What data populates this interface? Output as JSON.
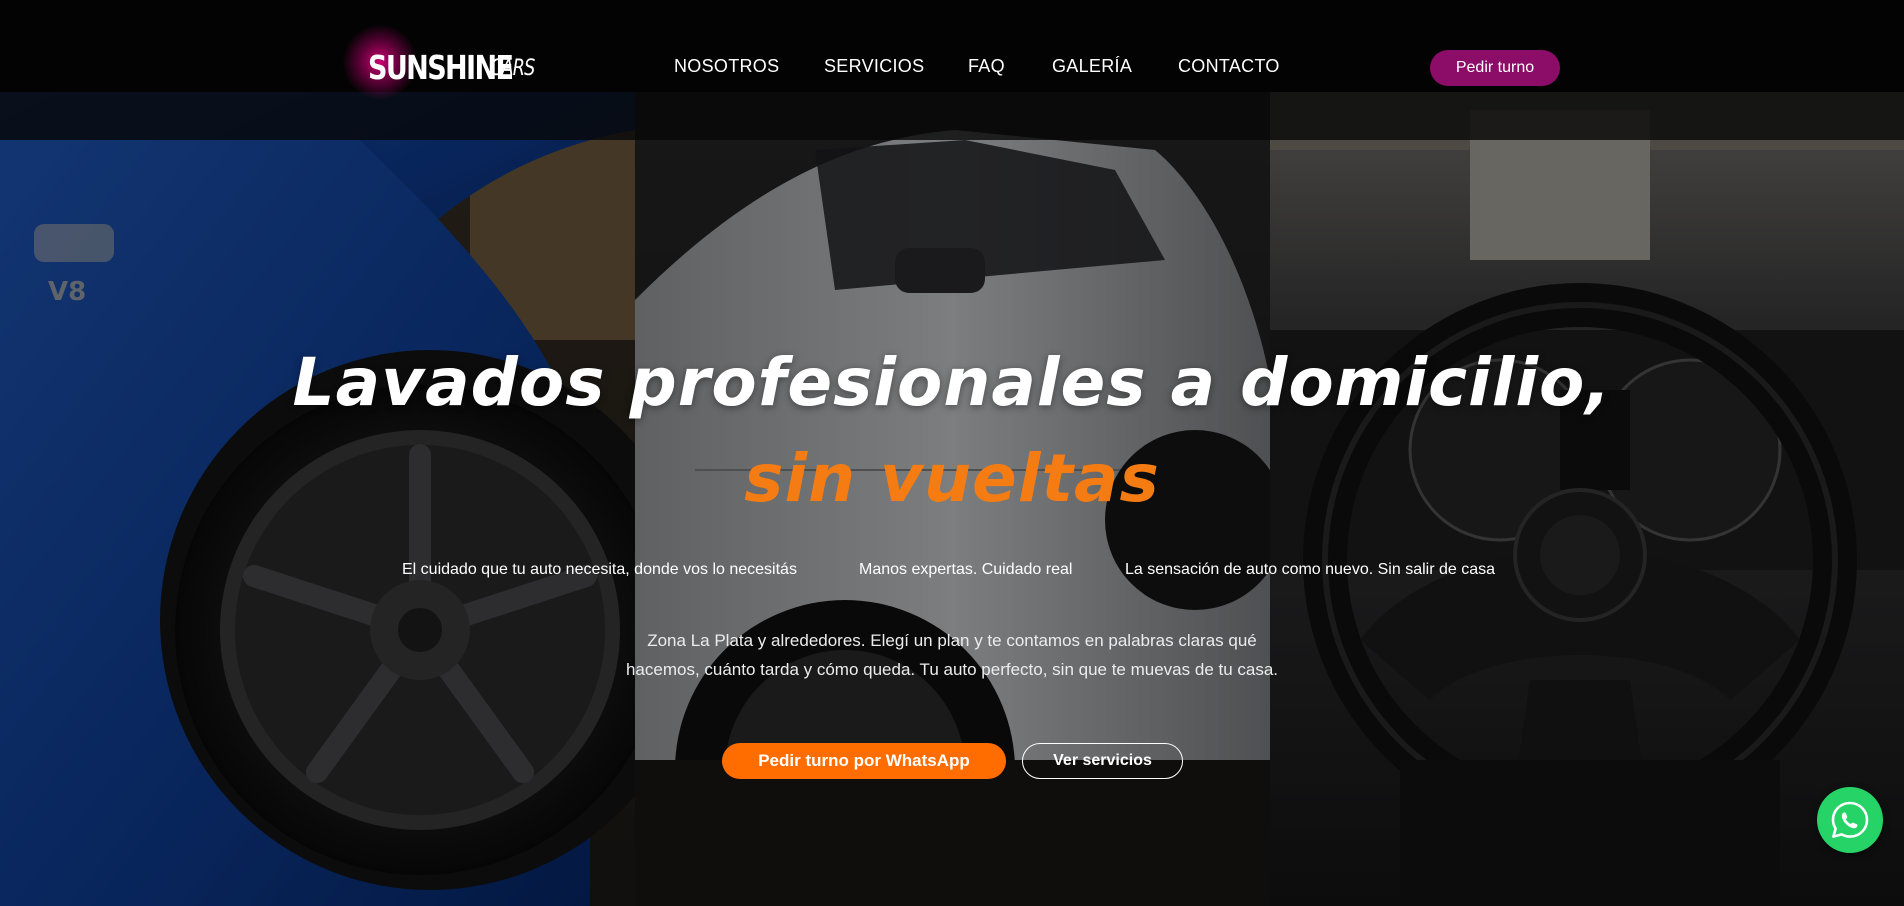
{
  "brand": {
    "name_main": "SUNSHINE",
    "name_sub": "CARS",
    "glow_color": "#d60078"
  },
  "nav": {
    "items": [
      {
        "label": "NOSOTROS"
      },
      {
        "label": "SERVICIOS"
      },
      {
        "label": "FAQ"
      },
      {
        "label": "GALERÍA"
      },
      {
        "label": "CONTACTO"
      }
    ],
    "cta_label": "Pedir turno",
    "cta_color": "#8c0d68"
  },
  "hero": {
    "headline": "Lavados profesionales a domicilio,",
    "headline_accent": "sin vueltas",
    "accent_color": "#f47c12",
    "taglines": [
      "El cuidado que tu auto necesita, donde vos lo necesitás",
      "Manos expertas. Cuidado real",
      "La sensación de auto como nuevo. Sin salir de casa"
    ],
    "description": "Zona La Plata y alrededores. Elegí un plan y te contamos en palabras claras qué hacemos, cuánto tarda y cómo queda. Tu auto perfecto, sin que te muevas de tu casa.",
    "primary_cta": "Pedir turno por WhatsApp",
    "primary_cta_color": "#ff6d00",
    "secondary_cta": "Ver servicios",
    "background_images": [
      "blue-car-wheel-photo",
      "silver-car-side-photo",
      "steering-wheel-interior-photo"
    ]
  },
  "floating": {
    "whatsapp_icon": "whatsapp-icon",
    "color": "#25d366"
  }
}
